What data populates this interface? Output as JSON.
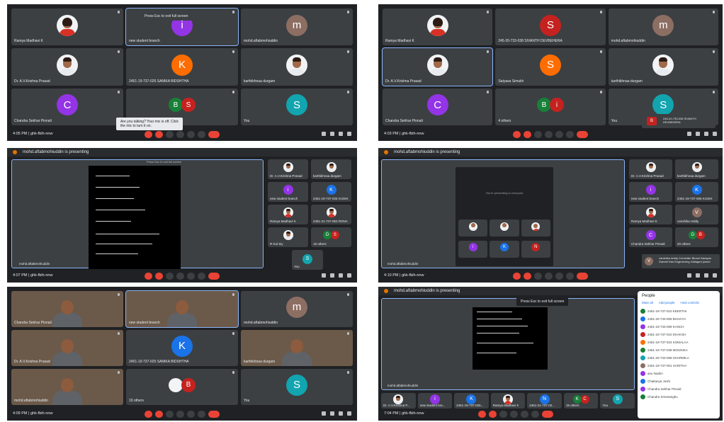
{
  "colors": {
    "meet_bg": "#202124",
    "tile_bg": "#3c4043",
    "accent_blue": "#8ab4f8",
    "end_red": "#ea4335",
    "avatar_purple": "#9334e6",
    "avatar_orange": "#ff6d00",
    "avatar_brown": "#8d6e63",
    "avatar_magenta": "#c5221f",
    "avatar_teal": "#12a4af",
    "avatar_blue": "#1a73e8",
    "avatar_green": "#188038"
  },
  "s1": {
    "toast": "Press Esc to exit full screen",
    "talk_toast": "Are you talking? Your mic is off. Click the mic to turn it on.",
    "time": "4:05 PM | ghk-fbih-nnw",
    "tiles": [
      {
        "name": "Ramya Madhavi K",
        "kind": "photo-f"
      },
      {
        "name": "new student branch",
        "kind": "avatar",
        "letter": "i",
        "color": "#9334e6",
        "active": true
      },
      {
        "name": "mohd.aftabmohiuddin",
        "kind": "avatar",
        "letter": "m",
        "color": "#8d6e63"
      },
      {
        "name": "Dr. A.V.Krishna Prasad",
        "kind": "photo"
      },
      {
        "name": "2451-19-737-026 SANIKA BIDSHTHA",
        "kind": "avatar",
        "letter": "K",
        "color": "#ff6d00"
      },
      {
        "name": "karthikhnaa durgam",
        "kind": "photo"
      },
      {
        "name": "Chandra Sekhar Pinnali",
        "kind": "avatar",
        "letter": "C",
        "color": "#9334e6"
      },
      {
        "name": "16 others",
        "kind": "pair",
        "letters": [
          "B",
          "S"
        ]
      },
      {
        "name": "You",
        "kind": "avatar",
        "letter": "S",
        "color": "#12a4af"
      }
    ]
  },
  "s2": {
    "time": "4:03 PM | ghk-fbih-nnw",
    "tiles": [
      {
        "name": "Ramya Madhavi K",
        "kind": "photo-f"
      },
      {
        "name": "245-20-733-038 SIVANTH DEVBEHERA",
        "kind": "avatar",
        "letter": "S",
        "color": "#c5221f"
      },
      {
        "name": "mohd.aftabmohiuddin",
        "kind": "avatar",
        "letter": "m",
        "color": "#8d6e63"
      },
      {
        "name": "Dr. A.V.Krishna Prasad",
        "kind": "photo",
        "active": true
      },
      {
        "name": "Satyasa Simukh",
        "kind": "avatar",
        "letter": "S",
        "color": "#ff6d00"
      },
      {
        "name": "karthikhnaa durgam",
        "kind": "photo"
      },
      {
        "name": "Chandra Sekhar Pinnali",
        "kind": "avatar",
        "letter": "C",
        "color": "#9334e6"
      },
      {
        "name": "4 others",
        "kind": "pair",
        "letters": [
          "B",
          "i"
        ]
      },
      {
        "name": "You",
        "kind": "avatar",
        "letter": "S",
        "color": "#12a4af"
      }
    ],
    "toast": "245-20-733-038 SIVANTH DEVBEHERA"
  },
  "s3": {
    "presenter": "mohd.aftabmohiuddin is presenting",
    "time": "4:07 PM | ghk-fbih-nnw",
    "board_caption": "Press Esc to exit full screen",
    "self": "mohd.aftabmohiuddin",
    "side": [
      {
        "name": "Dr. A.V.Krishna Prasad",
        "kind": "photo"
      },
      {
        "name": "karthikhnaa durgam",
        "kind": "photo"
      },
      {
        "name": "new student branch",
        "kind": "avatar",
        "letter": "i",
        "color": "#9334e6"
      },
      {
        "name": "2451-19-737-025 KUSHI",
        "kind": "avatar",
        "letter": "K",
        "color": "#1a73e8"
      },
      {
        "name": "Ramya Madhavi K",
        "kind": "photo-f"
      },
      {
        "name": "2451-21-737-053 RONA",
        "kind": "photo-f"
      },
      {
        "name": "R Kul Siy",
        "kind": "photo"
      },
      {
        "name": "19 others",
        "kind": "pair",
        "letters": [
          "D",
          "S"
        ]
      }
    ],
    "you": "You"
  },
  "s4": {
    "presenter": "mohd.aftabmohiuddin is presenting",
    "time": "4:10 PM | ghk-fbih-nnw",
    "inner_text": "You're presenting to everyone",
    "side": [
      {
        "name": "Dr. A.V.Krishna Prasad",
        "kind": "photo"
      },
      {
        "name": "karthikhnaa durgam",
        "kind": "photo"
      },
      {
        "name": "new student branch",
        "kind": "avatar",
        "letter": "i",
        "color": "#9334e6"
      },
      {
        "name": "2451-19-737-006 KUSHI",
        "kind": "avatar",
        "letter": "K",
        "color": "#1a73e8"
      },
      {
        "name": "Ramya Madhavi K",
        "kind": "photo-f"
      },
      {
        "name": "vanshika reddy",
        "kind": "avatar",
        "letter": "V",
        "color": "#8d6e63"
      },
      {
        "name": "Chandra Sekhar Pinnali",
        "kind": "avatar",
        "letter": "C",
        "color": "#9334e6"
      },
      {
        "name": "20 others",
        "kind": "pair",
        "letters": [
          "D",
          "B"
        ]
      }
    ],
    "toast": "vanshika reddy Cornelder Binani Narayan Gabriel Das Engineering Gallaged joined",
    "self": "mohd.aftabmohiuddin"
  },
  "s5": {
    "time": "4:09 PM | ghk-fbih-nnw",
    "tiles": [
      {
        "name": "Chandra Sekhar Pinnali",
        "kind": "cam"
      },
      {
        "name": "new student branch",
        "kind": "cam",
        "active": true
      },
      {
        "name": "mohd.aftabmohiuddin",
        "kind": "avatar",
        "letter": "m",
        "color": "#8d6e63"
      },
      {
        "name": "Dr. A.V.Krishna Prasad",
        "kind": "cam"
      },
      {
        "name": "2451-19-737-025 SANIKA BIDSHTHA",
        "kind": "avatar",
        "letter": "K",
        "color": "#1a73e8"
      },
      {
        "name": "karthikhnaa durgam",
        "kind": "cam"
      },
      {
        "name": "mohd.aftabmohiuddin",
        "kind": "cam"
      },
      {
        "name": "19 others",
        "kind": "pair",
        "letters": [
          "",
          "B"
        ]
      },
      {
        "name": "You",
        "kind": "avatar",
        "letter": "S",
        "color": "#12a4af"
      }
    ]
  },
  "s6": {
    "presenter": "mohd.aftabmohiuddin is presenting",
    "toast": "Press Esc to exit full screen",
    "time": "7:04 PM | ghk-fbih-nnw",
    "self": "mohd.aftabmohiuddin",
    "panel_title": "People",
    "tabs": [
      "Mute all",
      "Add people",
      "Host controls"
    ],
    "people": [
      {
        "name": "2451-19-737-010 KEERTHI",
        "color": "#188038"
      },
      {
        "name": "2451-20-733-006 BHAGYA",
        "color": "#1a73e8"
      },
      {
        "name": "2451-19-733-059 KANCH",
        "color": "#9334e6"
      },
      {
        "name": "2451-19-737-010 DHAKSH",
        "color": "#c5221f"
      },
      {
        "name": "2451-19-737-024 KOMALAA",
        "color": "#ff6d00"
      },
      {
        "name": "2451-19-737-038 MOUNIKA",
        "color": "#188038"
      },
      {
        "name": "2451-20-733-068 SHARMILA",
        "color": "#12a4af"
      },
      {
        "name": "2451-19-737-001 SARITHA",
        "color": "#8d6e63"
      },
      {
        "name": "anu Nadim",
        "color": "#9334e6"
      },
      {
        "name": "Chaitanya Joshi",
        "color": "#1a73e8"
      },
      {
        "name": "Chandra Sekhar Pinnali",
        "color": "#9334e6"
      },
      {
        "name": "Chandra Srivaranghu",
        "color": "#188038"
      }
    ],
    "strip": [
      {
        "name": "Dr. A.V.Krishna P...",
        "kind": "photo"
      },
      {
        "name": "new student bra...",
        "kind": "avatar",
        "letter": "i",
        "color": "#9334e6"
      },
      {
        "name": "2451-19-737-025...",
        "kind": "avatar",
        "letter": "K",
        "color": "#1a73e8"
      },
      {
        "name": "Ramya Madhavi K",
        "kind": "photo-f"
      },
      {
        "name": "2451-21-737-02...",
        "kind": "avatar",
        "letter": "N",
        "color": "#1a73e8"
      },
      {
        "name": "19 others",
        "kind": "pair",
        "letters": [
          "K",
          "C"
        ]
      },
      {
        "name": "You",
        "kind": "avatar",
        "letter": "S",
        "color": "#12a4af"
      }
    ]
  }
}
